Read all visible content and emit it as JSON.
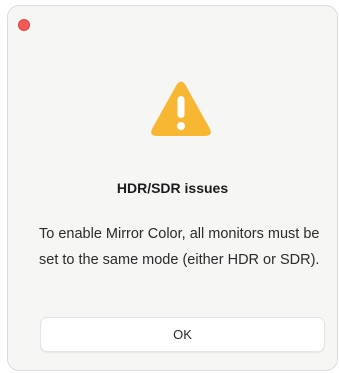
{
  "dialog": {
    "title": "HDR/SDR issues",
    "message": "To enable Mirror Color, all monitors must be set to the same mode (either HDR or SDR).",
    "ok_label": "OK"
  },
  "icons": {
    "close": "close-icon",
    "warning": "warning-icon"
  },
  "colors": {
    "close_dot": "#f35a55",
    "warning_fill": "#f7b733",
    "warning_glyph": "#ffffff",
    "dialog_bg": "#f6f6f5"
  }
}
